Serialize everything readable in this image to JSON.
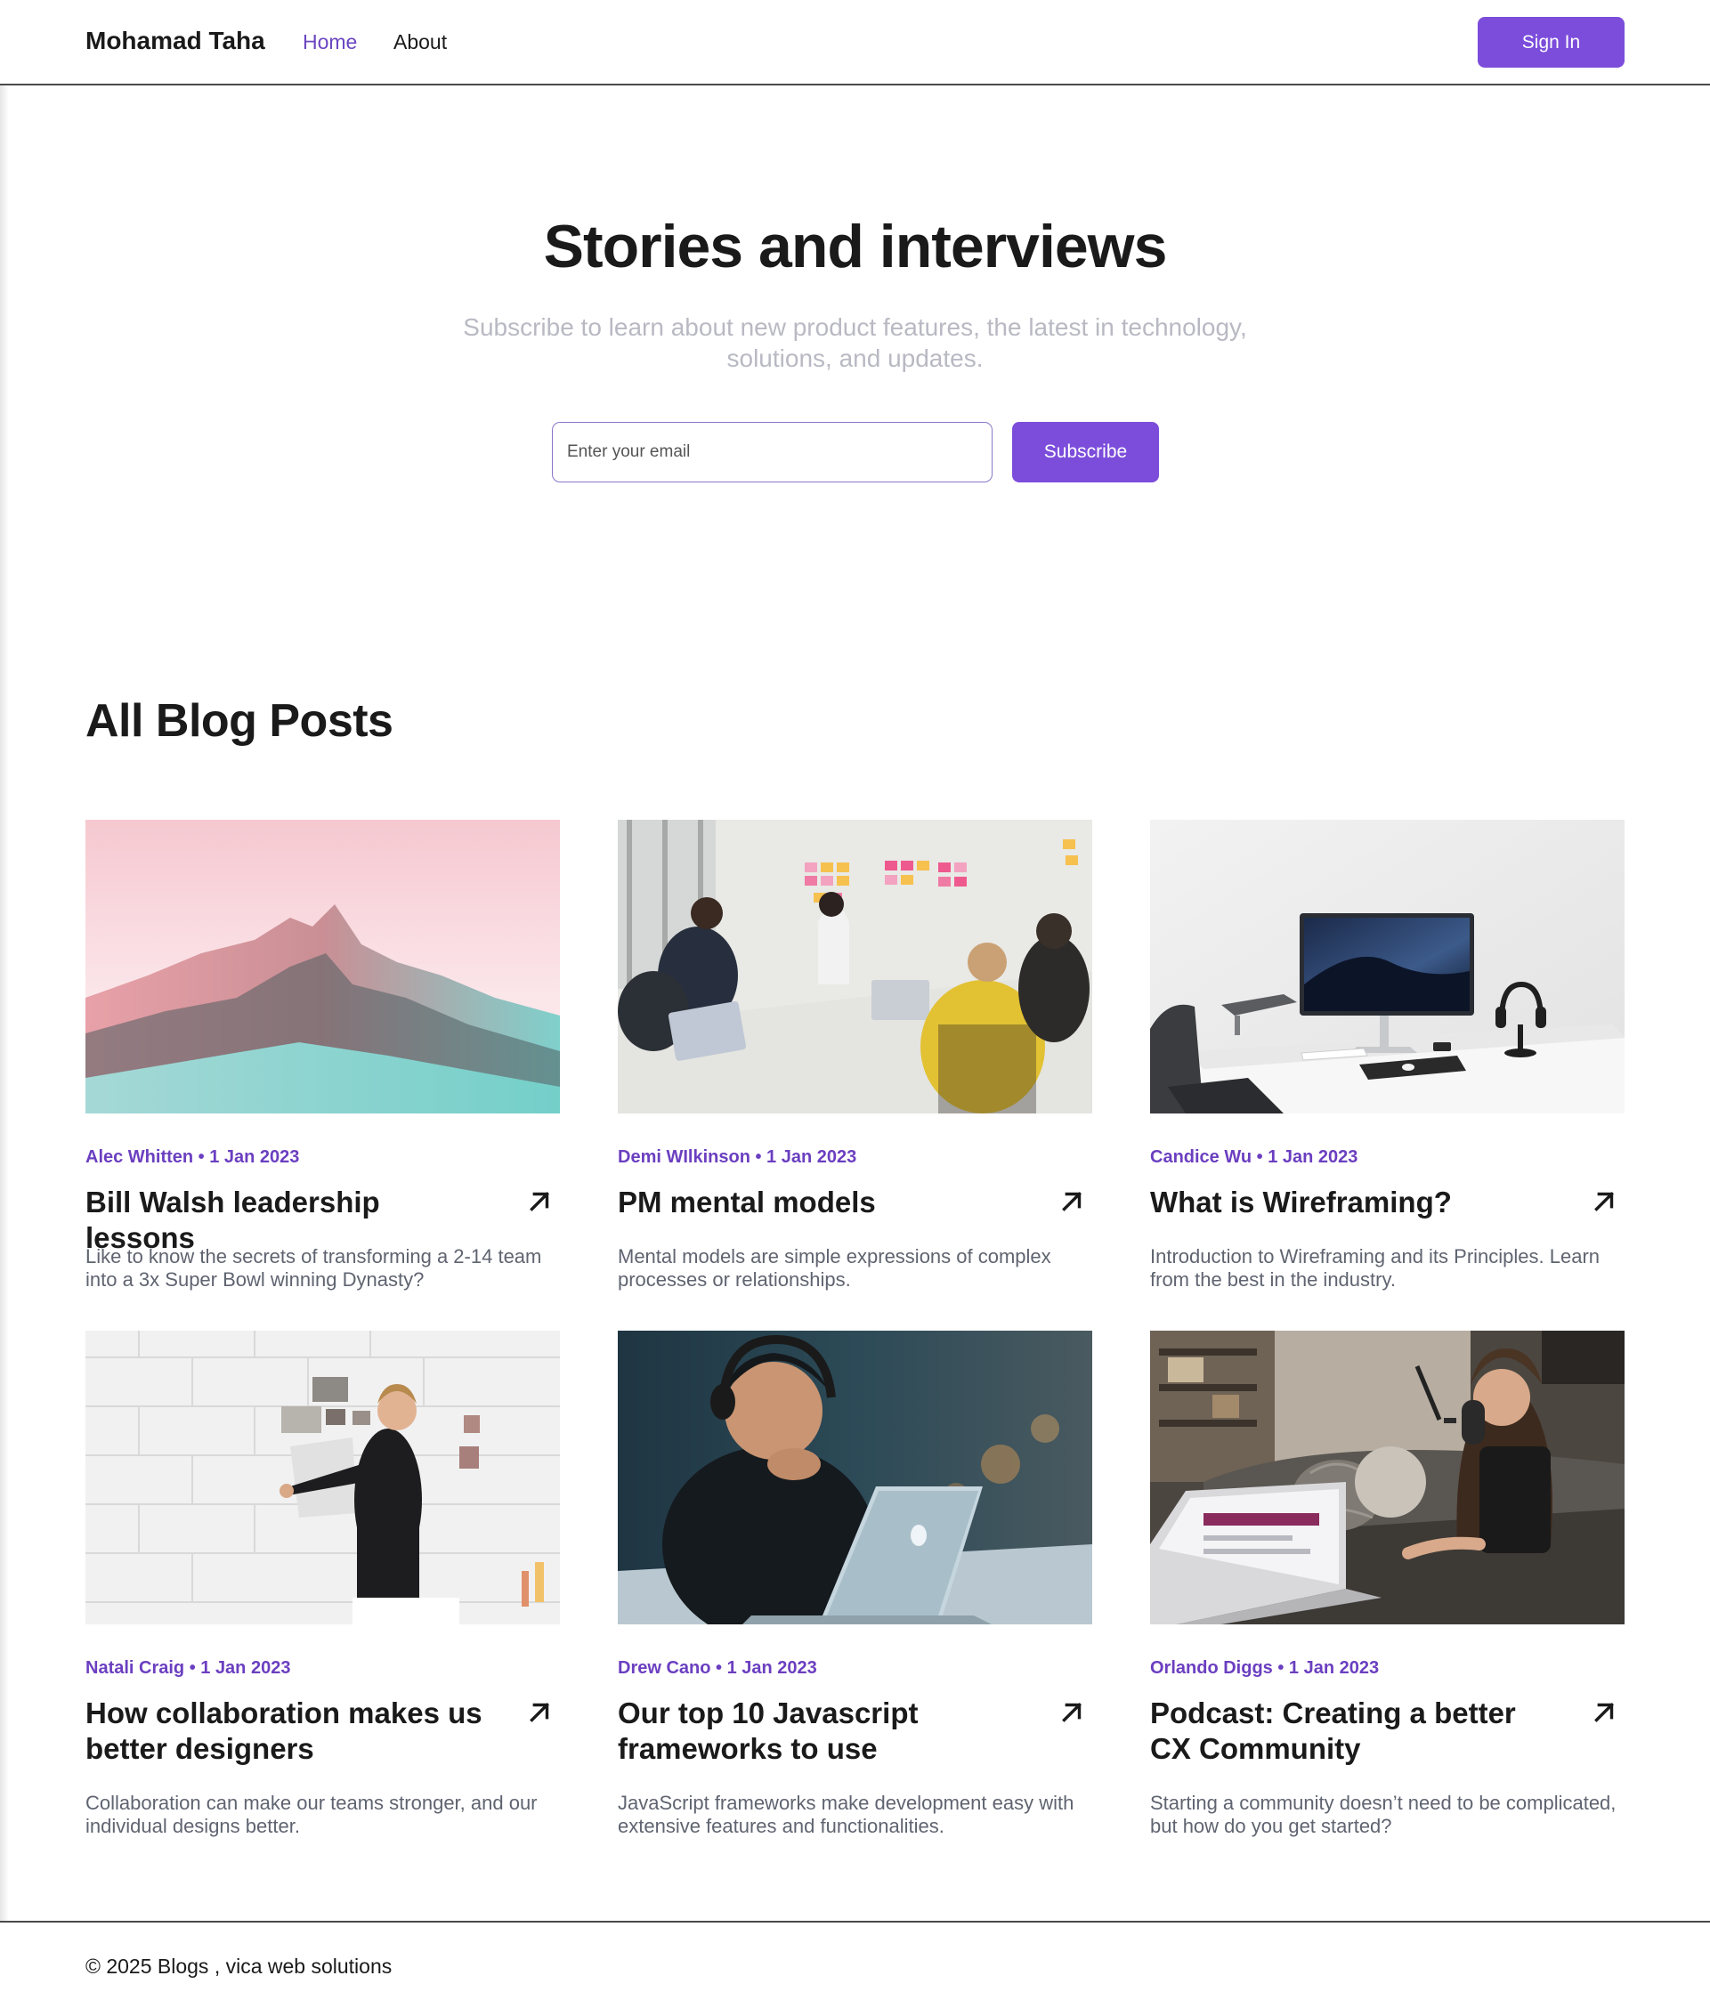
{
  "header": {
    "brand": "Mohamad Taha",
    "nav": [
      {
        "label": "Home",
        "active": true
      },
      {
        "label": "About",
        "active": false
      }
    ],
    "sign_in_label": "Sign In"
  },
  "hero": {
    "title": "Stories and interviews",
    "subtitle": "Subscribe to learn about new product features, the latest in technology, solutions, and updates.",
    "email_placeholder": "Enter your email",
    "subscribe_label": "Subscribe"
  },
  "posts_section": {
    "title": "All Blog Posts",
    "posts": [
      {
        "meta": "Alec Whitten • 1 Jan 2023",
        "title": "Bill Walsh leadership lessons",
        "excerpt": "Like to know the secrets of transforming a 2-14 team into a 3x Super Bowl winning Dynasty?",
        "image": "mountain-photo"
      },
      {
        "meta": "Demi WIlkinson • 1 Jan 2023",
        "title": "PM mental models",
        "excerpt": "Mental models are simple expressions of complex processes or relationships.",
        "image": "team-meeting-photo"
      },
      {
        "meta": "Candice Wu • 1 Jan 2023",
        "title": "What is Wireframing?",
        "excerpt": "Introduction to Wireframing and its Principles. Learn from the best in the industry.",
        "image": "desk-setup-photo"
      },
      {
        "meta": "Natali Craig • 1 Jan 2023",
        "title": "How collaboration makes us better designers",
        "excerpt": "Collaboration can make our teams stronger, and our individual designs better.",
        "image": "wall-board-photo"
      },
      {
        "meta": "Drew Cano • 1 Jan 2023",
        "title": "Our top 10 Javascript frameworks to use",
        "excerpt": "JavaScript frameworks make development easy with extensive features and functionalities.",
        "image": "laptop-headphones-photo"
      },
      {
        "meta": "Orlando Diggs • 1 Jan 2023",
        "title": "Podcast: Creating a better CX Community",
        "excerpt": "Starting a community doesn’t need to be complicated, but how do you get started?",
        "image": "podcast-photo"
      }
    ]
  },
  "footer": {
    "text": "© 2025 Blogs , vica web solutions"
  },
  "colors": {
    "accent": "#7c4ddb",
    "meta": "#6b3fc0",
    "text": "#1a1a1a",
    "muted": "#5f6470"
  },
  "icons": {
    "post_link": "arrow-up-right-icon"
  }
}
